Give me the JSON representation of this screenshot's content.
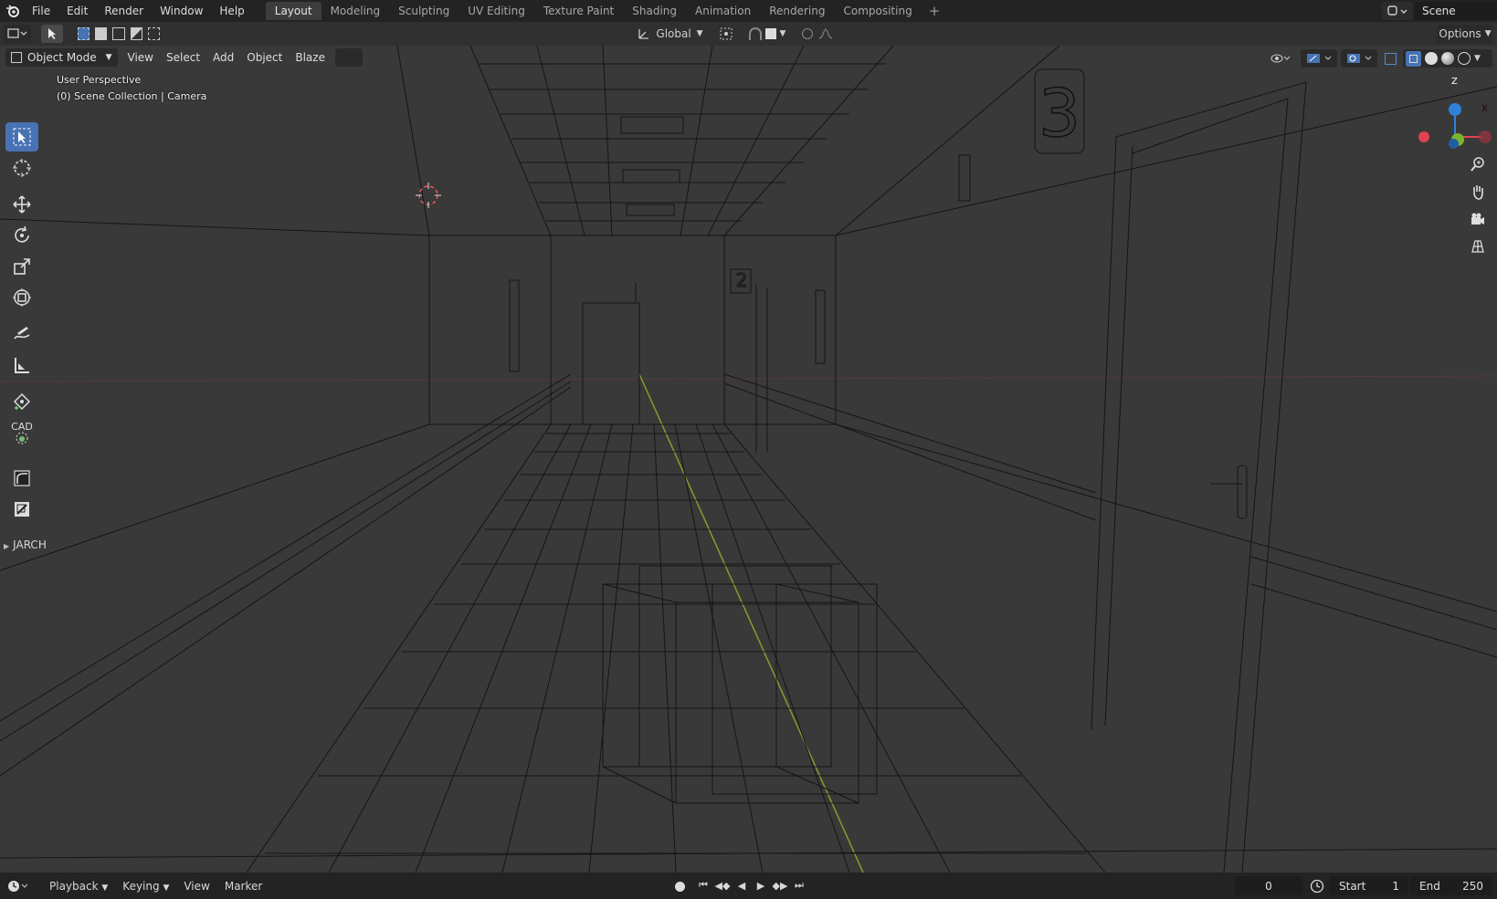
{
  "menubar": {
    "items": [
      "File",
      "Edit",
      "Render",
      "Window",
      "Help"
    ],
    "tabs": [
      "Layout",
      "Modeling",
      "Sculpting",
      "UV Editing",
      "Texture Paint",
      "Shading",
      "Animation",
      "Rendering",
      "Compositing"
    ],
    "active_tab": "Layout",
    "add_tab": "+",
    "scene_name": "Scene"
  },
  "tool_header": {
    "transform_orientation": "Global",
    "options_label": "Options"
  },
  "viewport_header": {
    "mode": "Object Mode",
    "menus": [
      "View",
      "Select",
      "Add",
      "Object",
      "Blaze"
    ]
  },
  "viewport": {
    "perspective": "User Perspective",
    "collection": "(0) Scene Collection | Camera",
    "gizmo": {
      "z": "Z",
      "y": "Y",
      "x": "X"
    },
    "door_number_front": "3",
    "door_number_back": "2",
    "colors": {
      "x_axis": "#e0434f",
      "y_axis": "#79b52f",
      "z_axis": "#2e83d8"
    }
  },
  "toolbar": {
    "tools": [
      "select-box",
      "cursor",
      "move",
      "rotate",
      "scale",
      "transform",
      "annotate",
      "measure",
      "add-cube",
      "cad",
      "bevel",
      "extrude"
    ],
    "cad_label": "CAD",
    "panel_label": "JARCH"
  },
  "timeline": {
    "menus": [
      "Playback",
      "Keying",
      "View",
      "Marker"
    ],
    "current_frame": "0",
    "start_label": "Start",
    "start_value": "1",
    "end_label": "End",
    "end_value": "250"
  }
}
